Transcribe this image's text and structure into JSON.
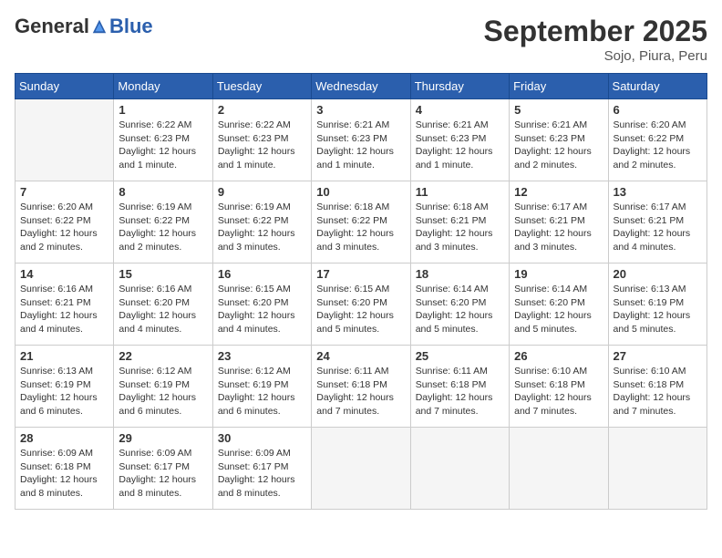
{
  "header": {
    "logo_general": "General",
    "logo_blue": "Blue",
    "month_title": "September 2025",
    "location": "Sojo, Piura, Peru"
  },
  "days_of_week": [
    "Sunday",
    "Monday",
    "Tuesday",
    "Wednesday",
    "Thursday",
    "Friday",
    "Saturday"
  ],
  "weeks": [
    [
      {
        "day": "",
        "info": ""
      },
      {
        "day": "1",
        "info": "Sunrise: 6:22 AM\nSunset: 6:23 PM\nDaylight: 12 hours\nand 1 minute."
      },
      {
        "day": "2",
        "info": "Sunrise: 6:22 AM\nSunset: 6:23 PM\nDaylight: 12 hours\nand 1 minute."
      },
      {
        "day": "3",
        "info": "Sunrise: 6:21 AM\nSunset: 6:23 PM\nDaylight: 12 hours\nand 1 minute."
      },
      {
        "day": "4",
        "info": "Sunrise: 6:21 AM\nSunset: 6:23 PM\nDaylight: 12 hours\nand 1 minute."
      },
      {
        "day": "5",
        "info": "Sunrise: 6:21 AM\nSunset: 6:23 PM\nDaylight: 12 hours\nand 2 minutes."
      },
      {
        "day": "6",
        "info": "Sunrise: 6:20 AM\nSunset: 6:22 PM\nDaylight: 12 hours\nand 2 minutes."
      }
    ],
    [
      {
        "day": "7",
        "info": "Sunrise: 6:20 AM\nSunset: 6:22 PM\nDaylight: 12 hours\nand 2 minutes."
      },
      {
        "day": "8",
        "info": "Sunrise: 6:19 AM\nSunset: 6:22 PM\nDaylight: 12 hours\nand 2 minutes."
      },
      {
        "day": "9",
        "info": "Sunrise: 6:19 AM\nSunset: 6:22 PM\nDaylight: 12 hours\nand 3 minutes."
      },
      {
        "day": "10",
        "info": "Sunrise: 6:18 AM\nSunset: 6:22 PM\nDaylight: 12 hours\nand 3 minutes."
      },
      {
        "day": "11",
        "info": "Sunrise: 6:18 AM\nSunset: 6:21 PM\nDaylight: 12 hours\nand 3 minutes."
      },
      {
        "day": "12",
        "info": "Sunrise: 6:17 AM\nSunset: 6:21 PM\nDaylight: 12 hours\nand 3 minutes."
      },
      {
        "day": "13",
        "info": "Sunrise: 6:17 AM\nSunset: 6:21 PM\nDaylight: 12 hours\nand 4 minutes."
      }
    ],
    [
      {
        "day": "14",
        "info": "Sunrise: 6:16 AM\nSunset: 6:21 PM\nDaylight: 12 hours\nand 4 minutes."
      },
      {
        "day": "15",
        "info": "Sunrise: 6:16 AM\nSunset: 6:20 PM\nDaylight: 12 hours\nand 4 minutes."
      },
      {
        "day": "16",
        "info": "Sunrise: 6:15 AM\nSunset: 6:20 PM\nDaylight: 12 hours\nand 4 minutes."
      },
      {
        "day": "17",
        "info": "Sunrise: 6:15 AM\nSunset: 6:20 PM\nDaylight: 12 hours\nand 5 minutes."
      },
      {
        "day": "18",
        "info": "Sunrise: 6:14 AM\nSunset: 6:20 PM\nDaylight: 12 hours\nand 5 minutes."
      },
      {
        "day": "19",
        "info": "Sunrise: 6:14 AM\nSunset: 6:20 PM\nDaylight: 12 hours\nand 5 minutes."
      },
      {
        "day": "20",
        "info": "Sunrise: 6:13 AM\nSunset: 6:19 PM\nDaylight: 12 hours\nand 5 minutes."
      }
    ],
    [
      {
        "day": "21",
        "info": "Sunrise: 6:13 AM\nSunset: 6:19 PM\nDaylight: 12 hours\nand 6 minutes."
      },
      {
        "day": "22",
        "info": "Sunrise: 6:12 AM\nSunset: 6:19 PM\nDaylight: 12 hours\nand 6 minutes."
      },
      {
        "day": "23",
        "info": "Sunrise: 6:12 AM\nSunset: 6:19 PM\nDaylight: 12 hours\nand 6 minutes."
      },
      {
        "day": "24",
        "info": "Sunrise: 6:11 AM\nSunset: 6:18 PM\nDaylight: 12 hours\nand 7 minutes."
      },
      {
        "day": "25",
        "info": "Sunrise: 6:11 AM\nSunset: 6:18 PM\nDaylight: 12 hours\nand 7 minutes."
      },
      {
        "day": "26",
        "info": "Sunrise: 6:10 AM\nSunset: 6:18 PM\nDaylight: 12 hours\nand 7 minutes."
      },
      {
        "day": "27",
        "info": "Sunrise: 6:10 AM\nSunset: 6:18 PM\nDaylight: 12 hours\nand 7 minutes."
      }
    ],
    [
      {
        "day": "28",
        "info": "Sunrise: 6:09 AM\nSunset: 6:18 PM\nDaylight: 12 hours\nand 8 minutes."
      },
      {
        "day": "29",
        "info": "Sunrise: 6:09 AM\nSunset: 6:17 PM\nDaylight: 12 hours\nand 8 minutes."
      },
      {
        "day": "30",
        "info": "Sunrise: 6:09 AM\nSunset: 6:17 PM\nDaylight: 12 hours\nand 8 minutes."
      },
      {
        "day": "",
        "info": ""
      },
      {
        "day": "",
        "info": ""
      },
      {
        "day": "",
        "info": ""
      },
      {
        "day": "",
        "info": ""
      }
    ]
  ]
}
